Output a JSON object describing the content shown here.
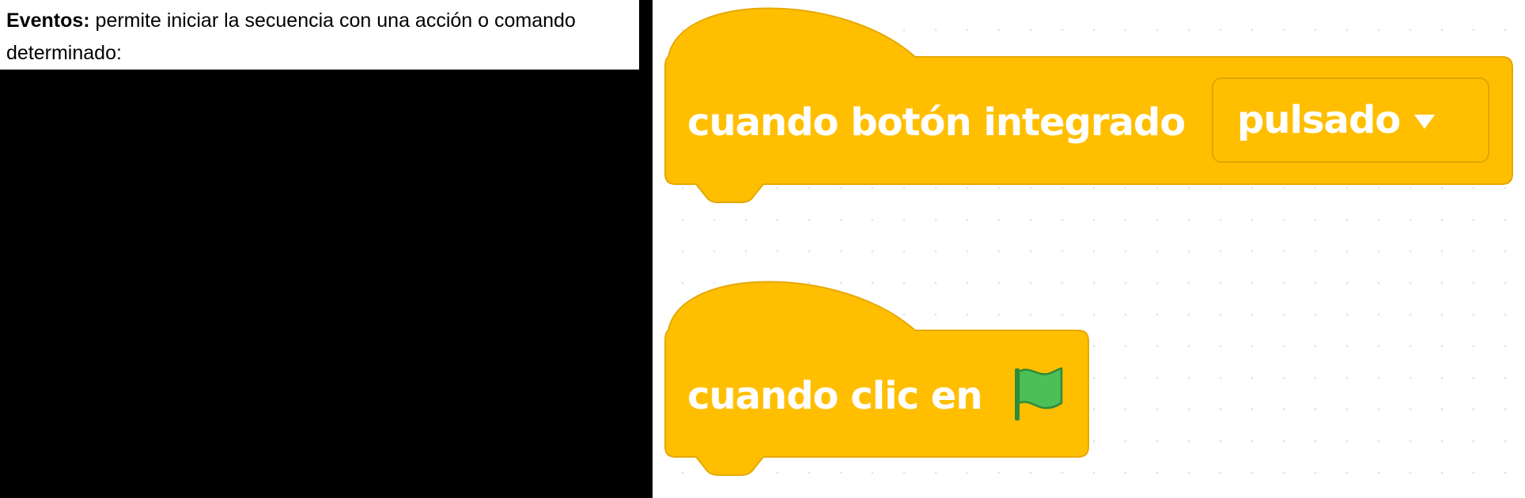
{
  "description_panel": {
    "title_bold": "Eventos:",
    "text_line1": " permite iniciar la secuencia con una acción o comando",
    "text_line2": "determinado:"
  },
  "blocks": [
    {
      "name": "when-button-pressed",
      "label": "cuando botón integrado",
      "dropdown_value": "pulsado",
      "dropdown_icon": "triangle-down-icon"
    },
    {
      "name": "when-flag-clicked",
      "label": "cuando clic en",
      "icon": "green-flag-icon"
    }
  ],
  "colors": {
    "block_fill": "#ffbf00",
    "block_stroke": "#e6a800",
    "dropdown_border": "#e0a400",
    "label_text": "#ffffff",
    "flag_fill": "#4cbf56",
    "flag_stroke": "#2e8b3b"
  }
}
